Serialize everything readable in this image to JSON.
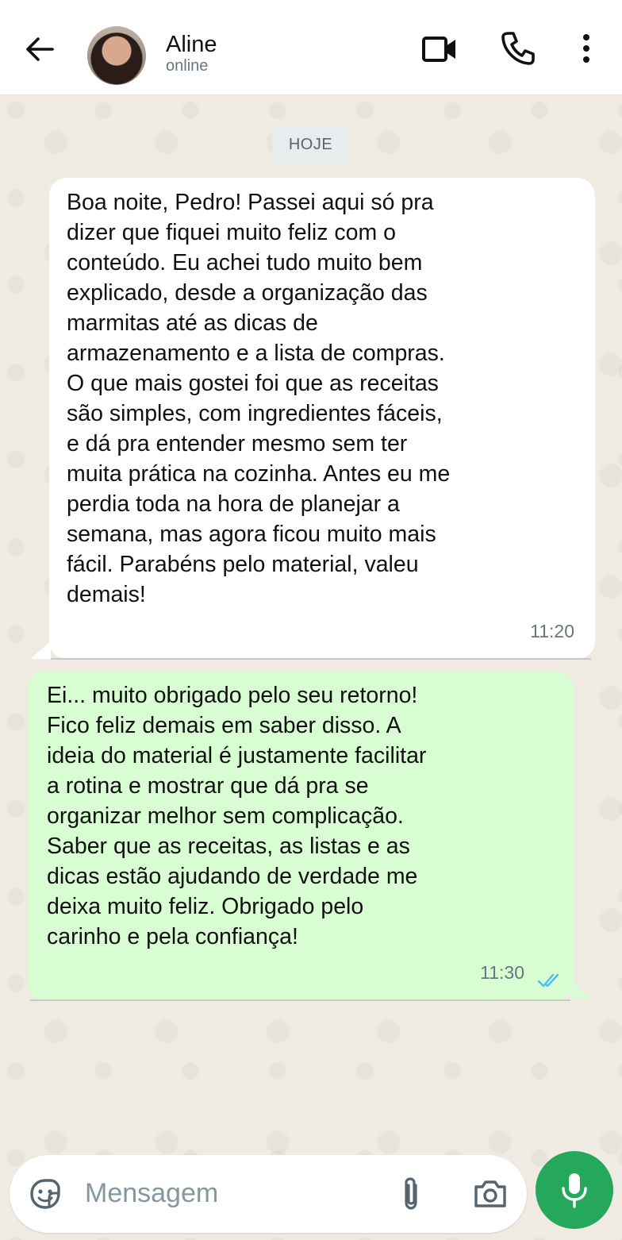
{
  "header": {
    "contact_name": "Aline",
    "contact_status": "online"
  },
  "chat": {
    "date_chip": "HOJE",
    "messages": [
      {
        "direction": "incoming",
        "text": "Boa noite, Pedro! Passei aqui só pra\ndizer que fiquei muito feliz com o\nconteúdo. Eu achei tudo muito bem\nexplicado, desde a organização das\nmarmitas até as dicas de\narmazenamento e a lista de compras.\nO que mais gostei foi que as receitas\nsão simples, com ingredientes fáceis,\ne dá pra entender mesmo sem ter\nmuita prática na cozinha. Antes eu me\nperdia toda na hora de planejar a\nsemana, mas agora ficou muito mais\nfácil. Parabéns pelo material, valeu\ndemais!",
        "time": "11:20"
      },
      {
        "direction": "outgoing",
        "text": "Ei... muito obrigado pelo seu retorno!\nFico feliz demais em saber disso. A\nideia do material é justamente facilitar\na rotina e mostrar que dá pra se\norganizar melhor sem complicação.\nSaber que as receitas, as listas e as\ndicas estão ajudando de verdade me\ndeixa muito feliz. Obrigado pelo\ncarinho e pela confiança!",
        "time": "11:30",
        "status": "read"
      }
    ]
  },
  "composer": {
    "placeholder": "Mensagem"
  },
  "colors": {
    "outgoing_bubble": "#d9fdd3",
    "incoming_bubble": "#ffffff",
    "accent_green": "#25a85b",
    "read_ticks": "#53bdeb"
  },
  "icons": [
    "back-arrow-icon",
    "video-call-icon",
    "phone-call-icon",
    "more-vertical-icon",
    "sticker-icon",
    "attach-icon",
    "camera-icon",
    "mic-icon",
    "double-check-icon"
  ]
}
